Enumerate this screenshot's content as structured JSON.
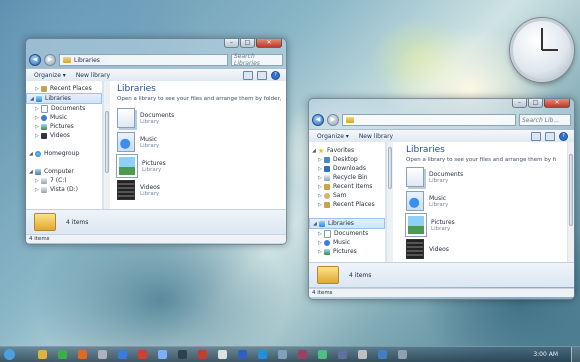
{
  "window1": {
    "address": "Libraries",
    "search_placeholder": "Search Libraries",
    "toolbar": {
      "organize": "Organize ▾",
      "new_library": "New library"
    },
    "nav": [
      {
        "label": "Recent Places",
        "icon": "recent",
        "indent": 1
      },
      {
        "label": "Libraries",
        "icon": "lib",
        "indent": 0,
        "selected": true
      },
      {
        "label": "Documents",
        "icon": "doc",
        "indent": 1
      },
      {
        "label": "Music",
        "icon": "music",
        "indent": 1
      },
      {
        "label": "Pictures",
        "icon": "pic",
        "indent": 1
      },
      {
        "label": "Videos",
        "icon": "vid",
        "indent": 1
      },
      {
        "label": "",
        "icon": "",
        "indent": 0
      },
      {
        "label": "Homegroup",
        "icon": "home",
        "indent": 0
      },
      {
        "label": "",
        "icon": "",
        "indent": 0
      },
      {
        "label": "Computer",
        "icon": "comp",
        "indent": 0
      },
      {
        "label": "7 (C:)",
        "icon": "drive",
        "indent": 1
      },
      {
        "label": "Vista (D:)",
        "icon": "drive",
        "indent": 1
      }
    ],
    "title": "Libraries",
    "subtitle": "Open a library to see your files and arrange them by folder, da...",
    "items": [
      {
        "name": "Documents",
        "type": "Library",
        "icon": "doc"
      },
      {
        "name": "Music",
        "type": "Library",
        "icon": "music"
      },
      {
        "name": "Pictures",
        "type": "Library",
        "icon": "pic"
      },
      {
        "name": "Videos",
        "type": "Library",
        "icon": "vid"
      }
    ],
    "details": "4 items",
    "status": "4 items"
  },
  "window2": {
    "search_placeholder": "Search Lib...",
    "toolbar": {
      "organize": "Organize ▾",
      "new_library": "New library"
    },
    "nav": [
      {
        "label": "Favorites",
        "icon": "star",
        "indent": 0
      },
      {
        "label": "Desktop",
        "icon": "desk",
        "indent": 1
      },
      {
        "label": "Downloads",
        "icon": "dl",
        "indent": 1
      },
      {
        "label": "Recycle Bin",
        "icon": "bin",
        "indent": 1
      },
      {
        "label": "Recent Items",
        "icon": "recent",
        "indent": 1
      },
      {
        "label": "Sam",
        "icon": "user",
        "indent": 1
      },
      {
        "label": "Recent Places",
        "icon": "recent",
        "indent": 1
      },
      {
        "label": "",
        "icon": "",
        "indent": 0
      },
      {
        "label": "Libraries",
        "icon": "lib",
        "indent": 0,
        "selected": true
      },
      {
        "label": "Documents",
        "icon": "doc",
        "indent": 1
      },
      {
        "label": "Music",
        "icon": "music",
        "indent": 1
      },
      {
        "label": "Pictures",
        "icon": "pic",
        "indent": 1
      }
    ],
    "title": "Libraries",
    "subtitle": "Open a library to see your files and arrange them by folder, da...",
    "items": [
      {
        "name": "Documents",
        "type": "Library",
        "icon": "doc"
      },
      {
        "name": "Music",
        "type": "Library",
        "icon": "music"
      },
      {
        "name": "Pictures",
        "type": "Library",
        "icon": "pic"
      },
      {
        "name": "Videos",
        "type": "",
        "icon": "vid"
      }
    ],
    "details": "4 items",
    "status": "4 items"
  },
  "taskbar": {
    "clock_text": "3:00 AM",
    "icons": [
      "start-orb",
      "explorer",
      "media-player",
      "firefox",
      "itunes",
      "chrome",
      "photoshop",
      "winamp",
      "app",
      "app",
      "app",
      "app",
      "app",
      "app",
      "app",
      "app",
      "app",
      "app",
      "app",
      "app"
    ]
  },
  "desktop_clock": {
    "hour": 3,
    "minute": 0
  }
}
